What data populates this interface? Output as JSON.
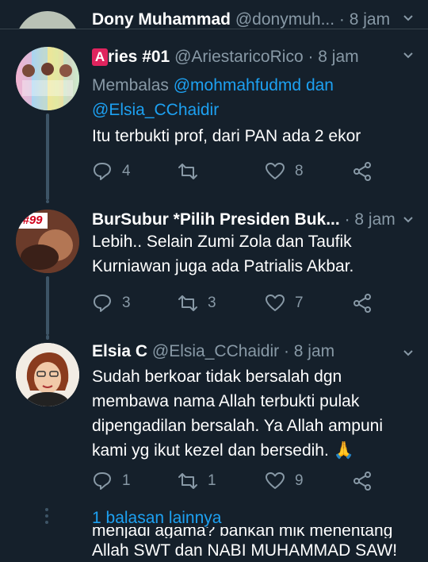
{
  "top_tweet": {
    "name": "Dony Muhammad",
    "handle": "@donymuh...",
    "time": "· 8 jam"
  },
  "tweets": [
    {
      "name": "Aries #01",
      "name_prefix_badge": "A",
      "name_rest": "ries #01",
      "handle": "@AriestaricoRico",
      "time": "· 8 jam",
      "reply_prefix": "Membalas",
      "reply_to_1": "@mohmahfudmd dan",
      "reply_to_2": "@Elsia_CChaidir",
      "text": "Itu terbukti prof, dari PAN ada 2 ekor",
      "reply_count": "4",
      "retweet_count": "",
      "like_count": "8"
    },
    {
      "name": "BurSubur *Pilih Presiden Buk...",
      "avatar_label": "#99",
      "handle": "",
      "time": "· 8 jam",
      "text_line_1": "Lebih.. Selain Zumi Zola dan Taufik",
      "text_line_2": "Kurniawan juga ada Patrialis Akbar.",
      "reply_count": "3",
      "retweet_count": "3",
      "like_count": "7"
    },
    {
      "name": "Elsia C",
      "handle": "@Elsia_CChaidir",
      "time": "· 8 jam",
      "text_line_1": "Sudah berkoar tidak bersalah dgn",
      "text_line_2": "membawa nama Allah terbukti pulak",
      "text_line_3": "dipengadilan bersalah. Ya Allah ampuni",
      "text_line_4": "kami yg ikut kezel dan bersedih.",
      "emoji": "🙏",
      "reply_count": "1",
      "retweet_count": "1",
      "like_count": "9"
    }
  ],
  "more_replies": "1 balasan lainnya",
  "bottom_text_1": "menjadi agama? bahkan mik menentang",
  "bottom_text_2": "Allah SWT dan NABI MUHAMMAD SAW!",
  "colors": {
    "background": "#15202b",
    "muted": "#8899a6",
    "link": "#1da1f2",
    "thread": "#3d5466"
  }
}
